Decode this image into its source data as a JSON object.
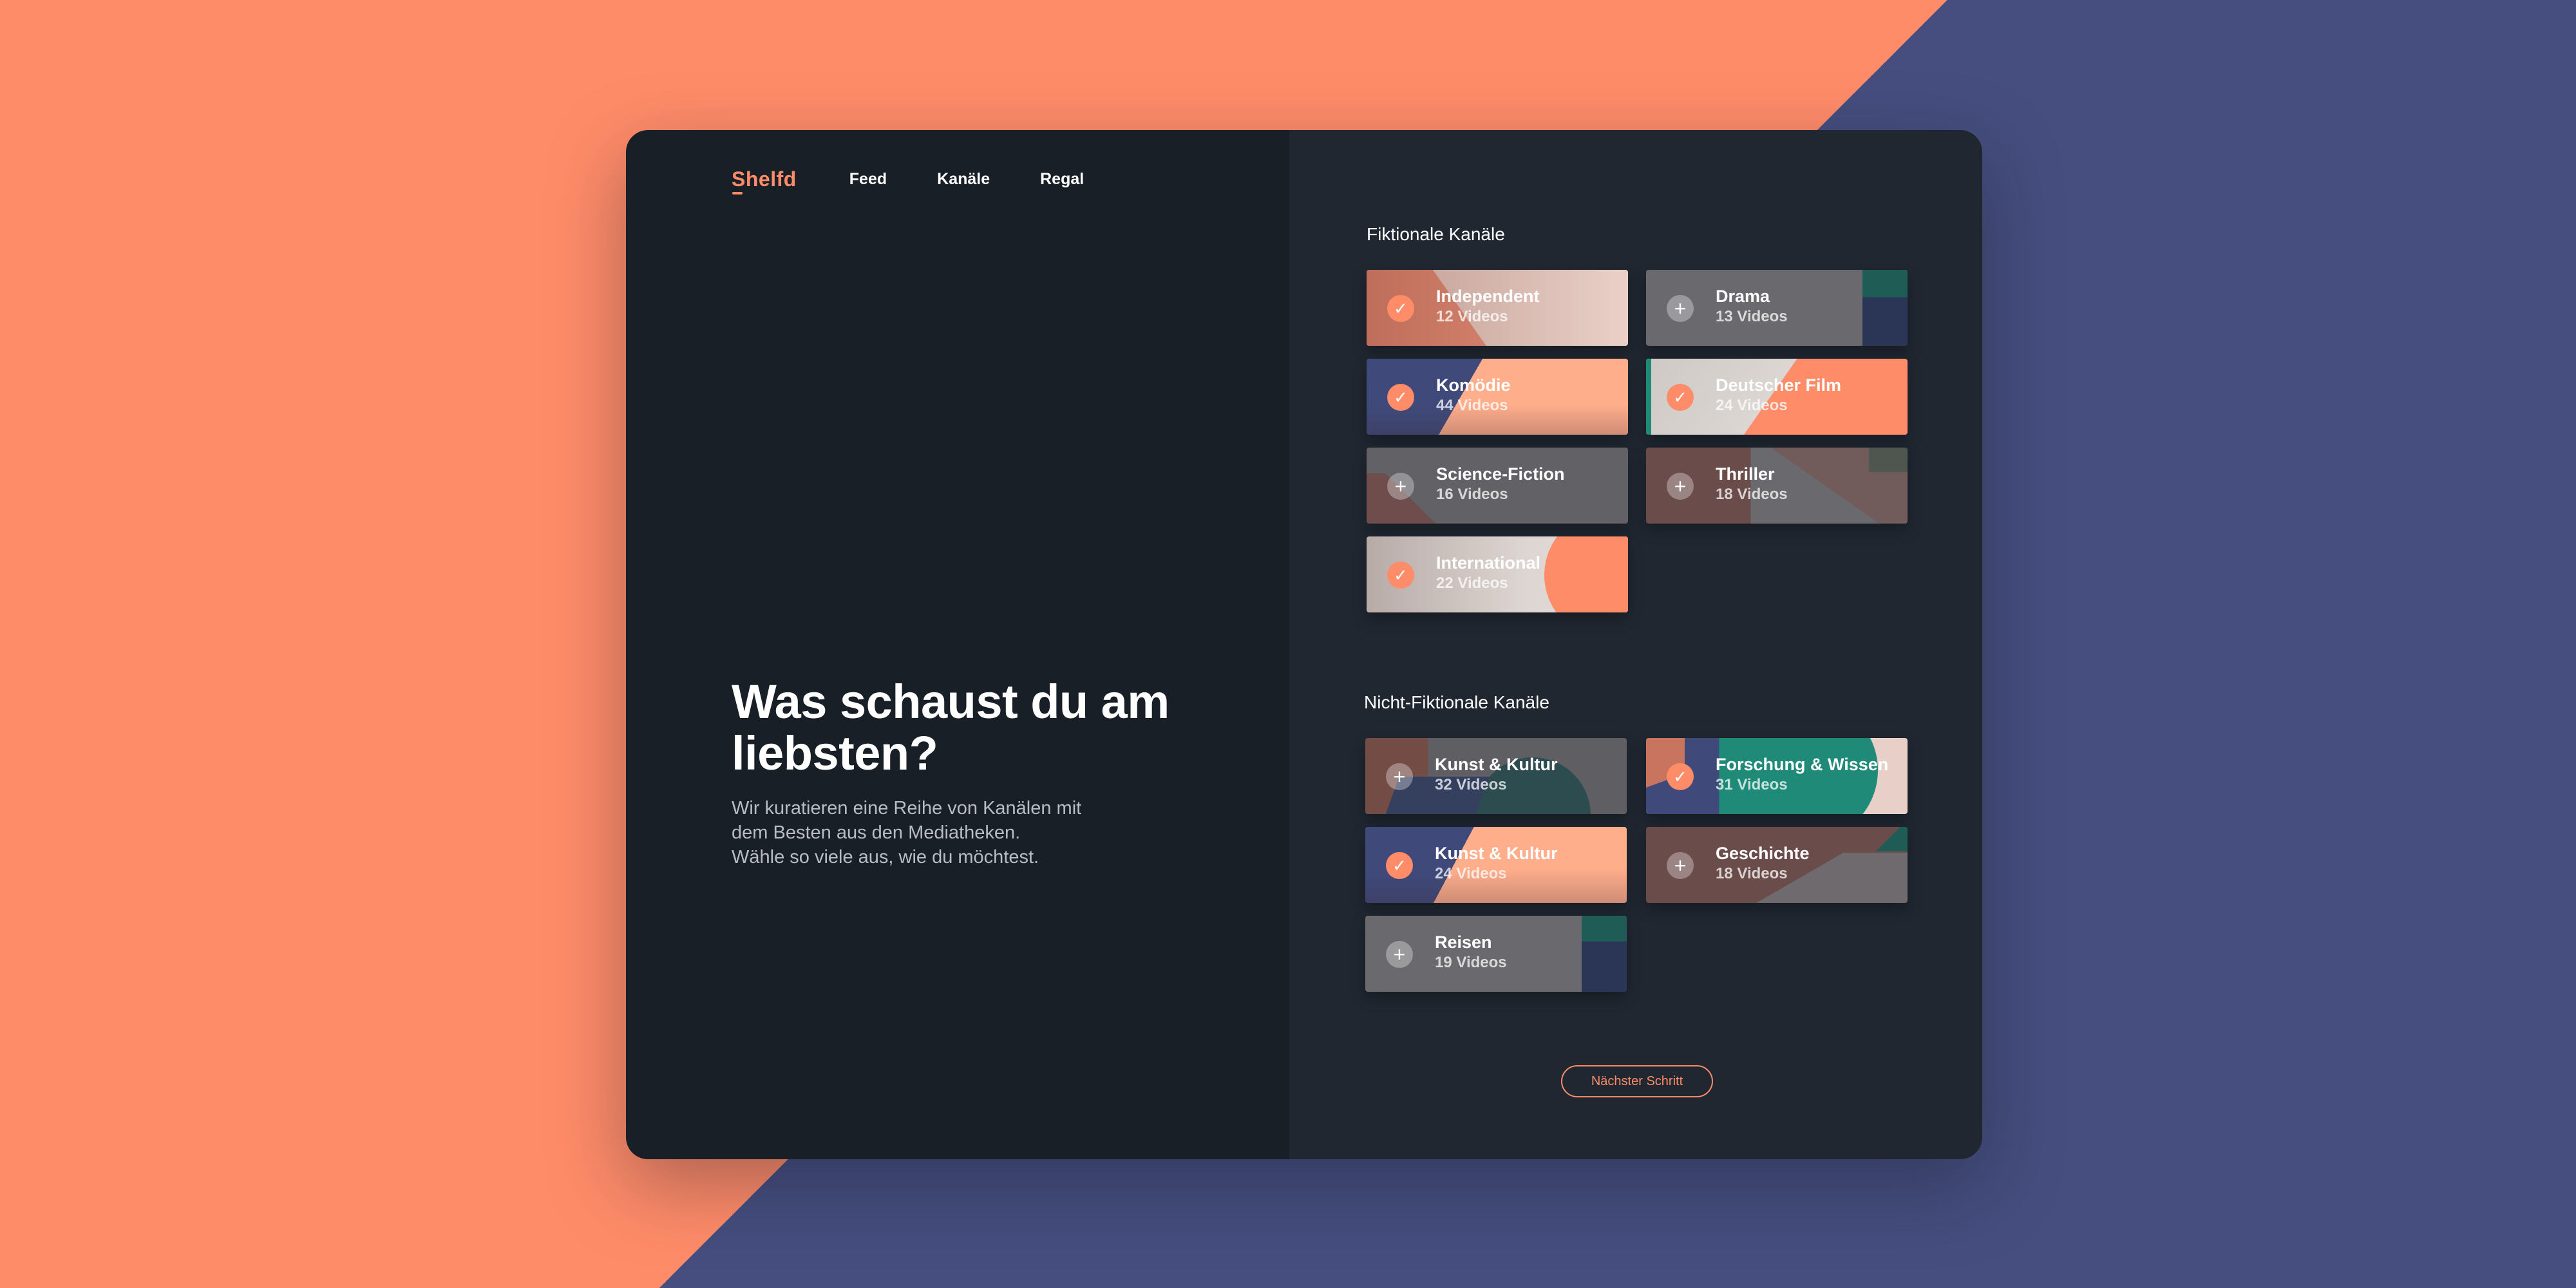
{
  "nav": {
    "logo": "Shelfd",
    "links": [
      "Feed",
      "Kanäle",
      "Regal"
    ]
  },
  "hero": {
    "title": "Was schaust du am liebsten?",
    "subtitle": "Wir kuratieren eine Reihe von Kanälen mit\ndem Besten aus den Mediatheken.\nWähle so viele aus, wie du möchtest."
  },
  "fiction": {
    "title": "Fiktionale Kanäle",
    "channels": [
      {
        "name": "Independent",
        "count": "12 Videos",
        "selected": true
      },
      {
        "name": "Drama",
        "count": "13 Videos",
        "selected": false
      },
      {
        "name": "Komödie",
        "count": "44 Videos",
        "selected": true
      },
      {
        "name": "Deutscher Film",
        "count": "24 Videos",
        "selected": true
      },
      {
        "name": "Science-Fiction",
        "count": "16 Videos",
        "selected": false
      },
      {
        "name": "Thriller",
        "count": "18 Videos",
        "selected": false
      },
      {
        "name": "International",
        "count": "22 Videos",
        "selected": true
      }
    ]
  },
  "nonfiction": {
    "title": "Nicht-Fiktionale Kanäle",
    "channels": [
      {
        "name": "Kunst & Kultur",
        "count": "32 Videos",
        "selected": false
      },
      {
        "name": "Forschung & Wissen",
        "count": "31 Videos",
        "selected": true
      },
      {
        "name": "Kunst & Kultur",
        "count": "24 Videos",
        "selected": true
      },
      {
        "name": "Geschichte",
        "count": "18 Videos",
        "selected": false
      },
      {
        "name": "Reisen",
        "count": "19 Videos",
        "selected": false
      }
    ]
  },
  "next_button": "Nächster Schritt",
  "icons": {
    "selected": "check-icon",
    "unselected": "plus-icon"
  },
  "colors": {
    "accent": "#FF8C69",
    "navy": "#454E7E",
    "teal": "#1F8A78",
    "panel_left": "#191F27",
    "panel_right": "#202731"
  }
}
